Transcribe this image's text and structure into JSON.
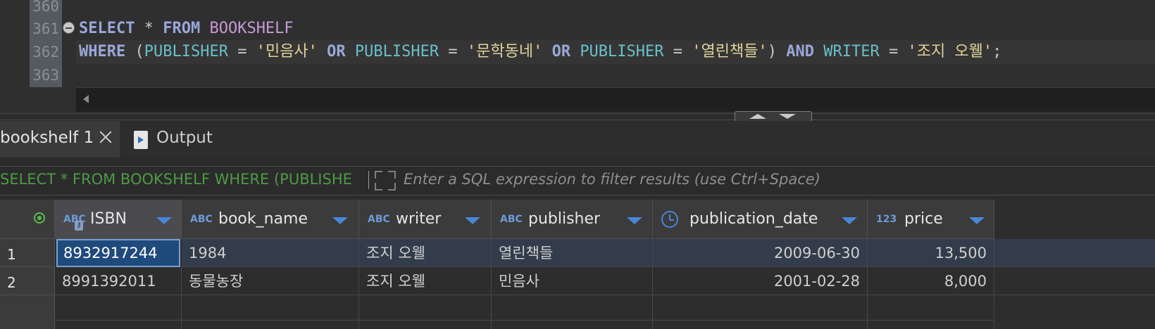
{
  "editor": {
    "line_numbers": [
      "360",
      "361",
      "362",
      "363"
    ],
    "line361": {
      "kw1": "SELECT",
      "star": " * ",
      "kw2": "FROM",
      "table": " BOOKSHELF"
    },
    "line362": {
      "kw_where": "WHERE",
      "paren_open": " (",
      "col1": "PUBLISHER",
      "eq1": " = ",
      "str1": "'민음사'",
      "or1": " OR ",
      "col2": "PUBLISHER",
      "eq2": " = ",
      "str2": "'문학동네'",
      "or2": " OR ",
      "col3": "PUBLISHER",
      "eq3": " = ",
      "str3": "'열린책들'",
      "paren_close": ") ",
      "and": "AND",
      "col4": " WRITER",
      "eq4": " = ",
      "str4": "'조지 오웰'",
      "semi": ";"
    }
  },
  "tabs": {
    "result_tab": "bookshelf 1",
    "output_tab": "Output"
  },
  "filter": {
    "query_text": "SELECT * FROM BOOKSHELF WHERE (PUBLISHE",
    "placeholder": "Enter a SQL expression to filter results (use Ctrl+Space)"
  },
  "grid": {
    "columns": [
      {
        "type": "ABC",
        "name": "ISBN"
      },
      {
        "type": "ABC",
        "name": "book_name"
      },
      {
        "type": "ABC",
        "name": "writer"
      },
      {
        "type": "ABC",
        "name": "publisher"
      },
      {
        "type": "",
        "name": "publication_date"
      },
      {
        "type": "123",
        "name": "price"
      }
    ],
    "rows": [
      {
        "num": "1",
        "cells": [
          "8932917244",
          "1984",
          "조지 오웰",
          "열린책들",
          "2009-06-30",
          "13,500"
        ]
      },
      {
        "num": "2",
        "cells": [
          "8991392011",
          "동물농장",
          "조지 오웰",
          "민음사",
          "2001-02-28",
          "8,000"
        ]
      }
    ]
  },
  "colors": {
    "keyword": "#9aa7d8",
    "column": "#6bbfc8",
    "table": "#c79ad5",
    "string": "#e2d39a",
    "filter_query": "#4e9a45",
    "selection": "#1f4a7c"
  }
}
